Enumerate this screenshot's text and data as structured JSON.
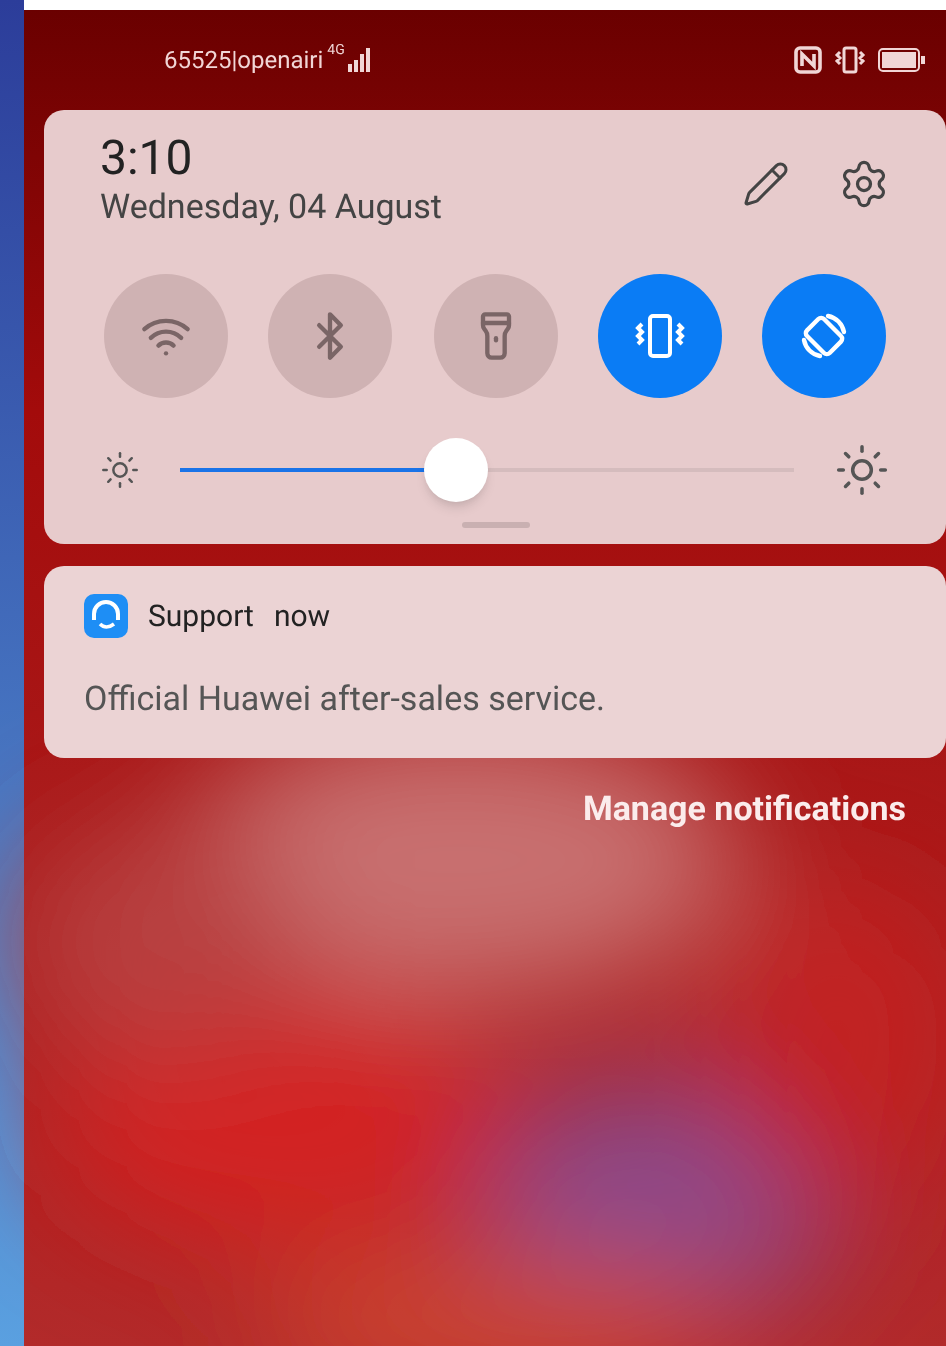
{
  "status_bar": {
    "carrier": "65525|openairi",
    "network_type": "4G"
  },
  "quick_panel": {
    "time": "3:10",
    "date": "Wednesday, 04 August",
    "toggles": [
      {
        "kind": "wifi",
        "on": false
      },
      {
        "kind": "bluetooth",
        "on": false
      },
      {
        "kind": "flashlight",
        "on": false
      },
      {
        "kind": "vibrate",
        "on": true
      },
      {
        "kind": "rotate",
        "on": true
      }
    ],
    "brightness": {
      "level": 0.45
    }
  },
  "notification": {
    "app": "Support",
    "time": "now",
    "body": "Official Huawei after-sales service."
  },
  "manage_link": "Manage notifications"
}
